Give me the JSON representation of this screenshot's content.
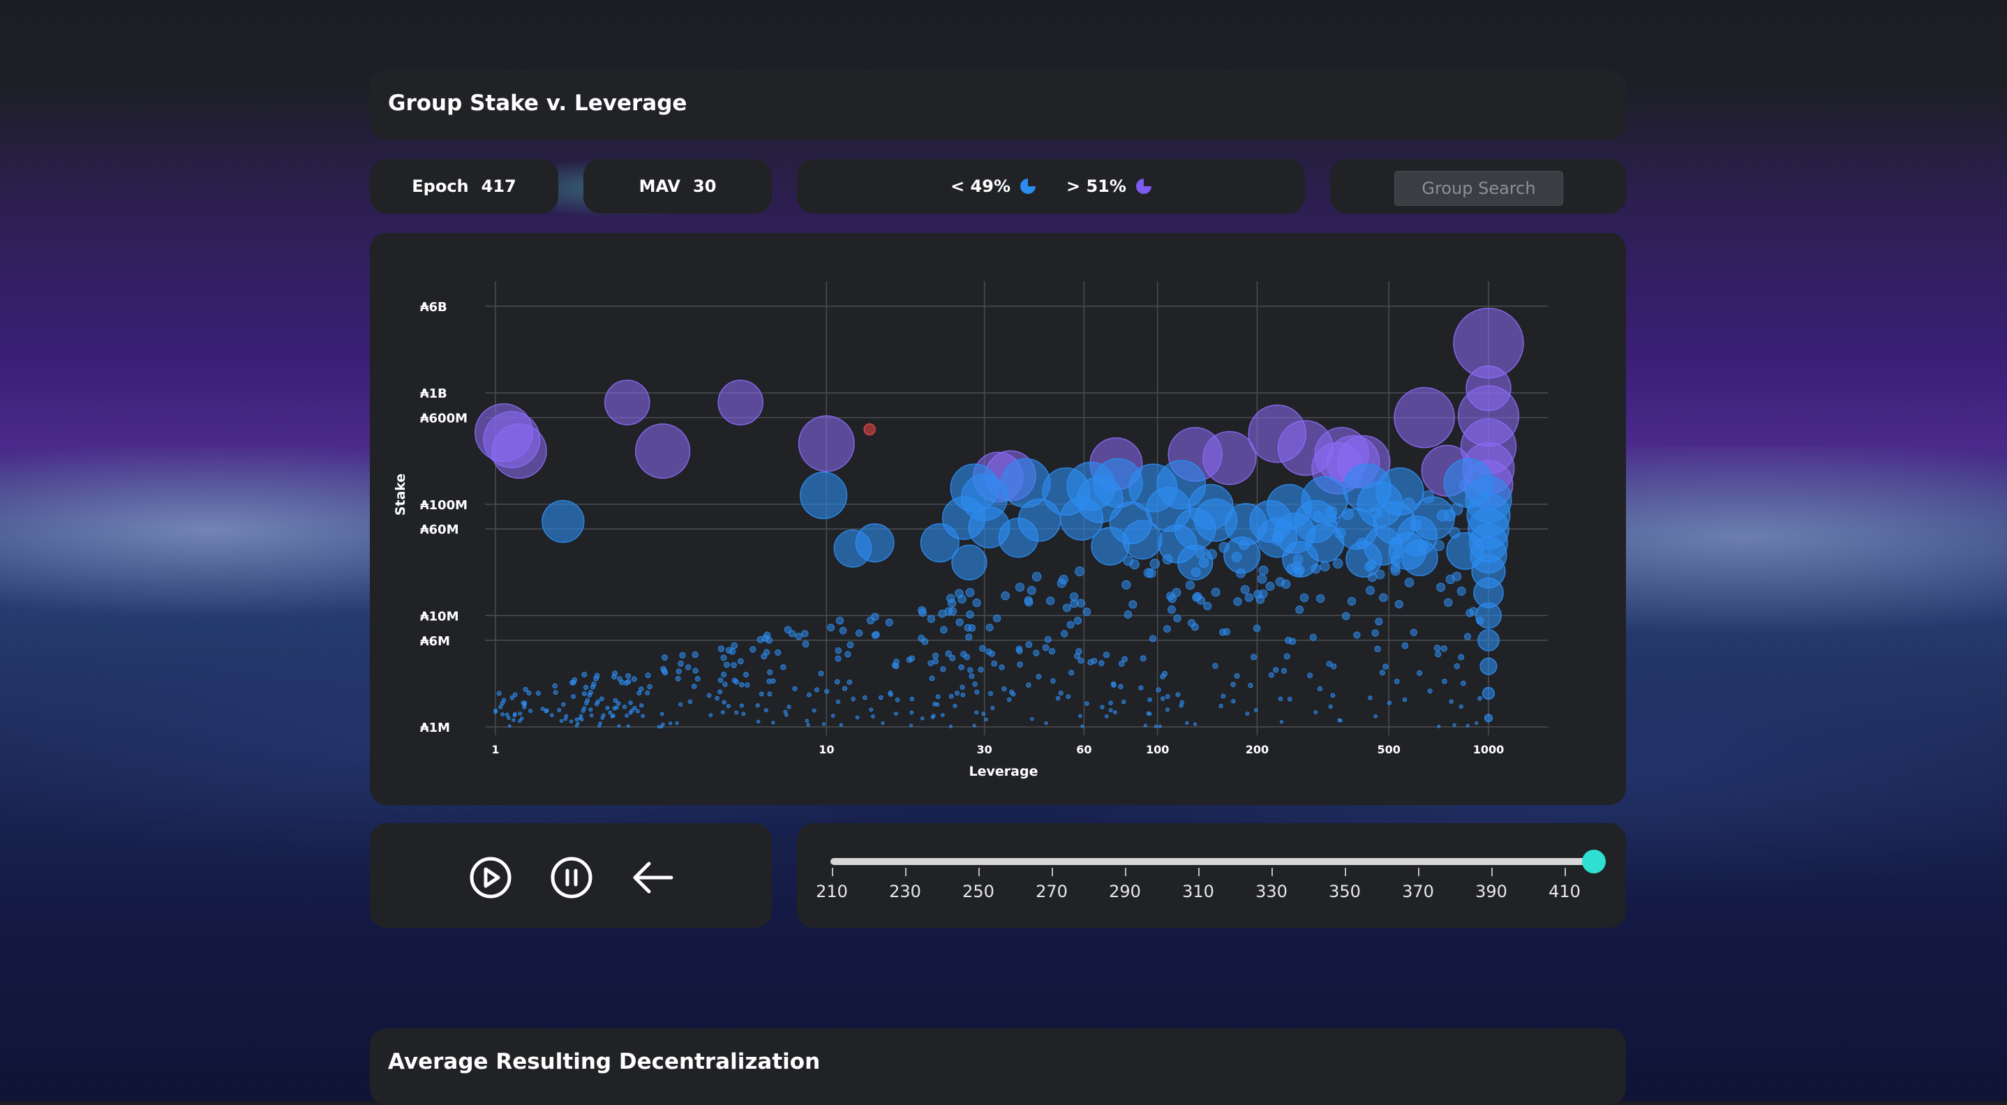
{
  "header": {
    "title": "Group Stake v. Leverage"
  },
  "stats": {
    "epoch_label": "Epoch",
    "epoch_value": "417",
    "mav_label": "MAV",
    "mav_value": "30",
    "below_label": "< 49%",
    "above_label": "> 51%",
    "below_color": "#2d8cf0",
    "above_color": "#7c5cf0"
  },
  "search": {
    "placeholder": "Group Search"
  },
  "controls": {
    "play_icon": "play-icon",
    "pause_icon": "pause-icon",
    "back_icon": "arrow-left-icon"
  },
  "slider": {
    "ticks": [
      "210",
      "230",
      "250",
      "270",
      "290",
      "310",
      "330",
      "350",
      "370",
      "390",
      "410"
    ],
    "min": 210,
    "max": 417,
    "value": 417,
    "thumb_color": "#2ee0d2"
  },
  "footer": {
    "title": "Average Resulting Decentralization"
  },
  "chart_data": {
    "type": "scatter",
    "xlabel": "Leverage",
    "ylabel": "Stake",
    "x_scale": "log",
    "y_scale": "log",
    "xlim": [
      1,
      2000
    ],
    "ylim": [
      1000000,
      9000000000
    ],
    "x_ticks": [
      {
        "v": 1,
        "label": "1"
      },
      {
        "v": 10,
        "label": "10"
      },
      {
        "v": 30,
        "label": "30"
      },
      {
        "v": 60,
        "label": "60"
      },
      {
        "v": 100,
        "label": "100"
      },
      {
        "v": 200,
        "label": "200"
      },
      {
        "v": 500,
        "label": "500"
      },
      {
        "v": 1000,
        "label": "1000"
      }
    ],
    "y_ticks": [
      {
        "v": 1000000,
        "label": "₳1M"
      },
      {
        "v": 6000000,
        "label": "₳6M"
      },
      {
        "v": 10000000,
        "label": "₳10M"
      },
      {
        "v": 60000000,
        "label": "₳60M"
      },
      {
        "v": 100000000,
        "label": "₳100M"
      },
      {
        "v": 600000000,
        "label": "₳600M"
      },
      {
        "v": 1000000000,
        "label": "₳1B"
      },
      {
        "v": 6000000000,
        "label": "₳6B"
      }
    ],
    "grid": true,
    "colors": {
      "below": "#2d8cf0",
      "above": "#8a6cf5",
      "highlight": "#e04646"
    },
    "points": [
      {
        "x": 1.06,
        "y": 440000000,
        "c": "above"
      },
      {
        "x": 1.12,
        "y": 380000000,
        "c": "above"
      },
      {
        "x": 1.18,
        "y": 300000000,
        "c": "above"
      },
      {
        "x": 2.5,
        "y": 820000000,
        "c": "above"
      },
      {
        "x": 5.5,
        "y": 820000000,
        "c": "above"
      },
      {
        "x": 3.2,
        "y": 300000000,
        "c": "above"
      },
      {
        "x": 10,
        "y": 350000000,
        "c": "above"
      },
      {
        "x": 1.6,
        "y": 70000000,
        "c": "below"
      },
      {
        "x": 9.8,
        "y": 120000000,
        "c": "below"
      },
      {
        "x": 13.5,
        "y": 470000000,
        "c": "highlight"
      },
      {
        "x": 1000,
        "y": 2800000000,
        "c": "above"
      },
      {
        "x": 1000,
        "y": 1100000000,
        "c": "above"
      },
      {
        "x": 1000,
        "y": 620000000,
        "c": "above"
      },
      {
        "x": 1000,
        "y": 330000000,
        "c": "above"
      },
      {
        "x": 1000,
        "y": 210000000,
        "c": "above"
      },
      {
        "x": 1000,
        "y": 150000000,
        "c": "above"
      },
      {
        "x": 1000,
        "y": 110000000,
        "c": "below"
      },
      {
        "x": 1000,
        "y": 80000000,
        "c": "below"
      },
      {
        "x": 1000,
        "y": 60000000,
        "c": "below"
      },
      {
        "x": 1000,
        "y": 45000000,
        "c": "below"
      },
      {
        "x": 1000,
        "y": 35000000,
        "c": "below"
      },
      {
        "x": 1000,
        "y": 25000000,
        "c": "below"
      },
      {
        "x": 1000,
        "y": 16000000,
        "c": "below"
      },
      {
        "x": 1000,
        "y": 10000000,
        "c": "below"
      },
      {
        "x": 1000,
        "y": 6000000,
        "c": "below"
      },
      {
        "x": 1000,
        "y": 3500000,
        "c": "below"
      },
      {
        "x": 1000,
        "y": 2000000,
        "c": "below"
      },
      {
        "x": 1000,
        "y": 1200000,
        "c": "below"
      },
      {
        "x": 640,
        "y": 600000000,
        "c": "above"
      },
      {
        "x": 230,
        "y": 430000000,
        "c": "above"
      },
      {
        "x": 280,
        "y": 320000000,
        "c": "above"
      },
      {
        "x": 130,
        "y": 280000000,
        "c": "above"
      },
      {
        "x": 165,
        "y": 260000000,
        "c": "above"
      },
      {
        "x": 75,
        "y": 230000000,
        "c": "above"
      },
      {
        "x": 360,
        "y": 280000000,
        "c": "above"
      },
      {
        "x": 390,
        "y": 240000000,
        "c": "above"
      },
      {
        "x": 420,
        "y": 240000000,
        "c": "above"
      },
      {
        "x": 350,
        "y": 210000000,
        "c": "above"
      },
      {
        "x": 36,
        "y": 180000000,
        "c": "above"
      },
      {
        "x": 33,
        "y": 175000000,
        "c": "above"
      },
      {
        "x": 750,
        "y": 200000000,
        "c": "above"
      },
      {
        "x": 28,
        "y": 140000000,
        "c": "below"
      },
      {
        "x": 40,
        "y": 155000000,
        "c": "below"
      },
      {
        "x": 53,
        "y": 130000000,
        "c": "below"
      },
      {
        "x": 63,
        "y": 145000000,
        "c": "below"
      },
      {
        "x": 76,
        "y": 155000000,
        "c": "below"
      },
      {
        "x": 97,
        "y": 140000000,
        "c": "below"
      },
      {
        "x": 118,
        "y": 150000000,
        "c": "below"
      },
      {
        "x": 430,
        "y": 140000000,
        "c": "below"
      },
      {
        "x": 540,
        "y": 130000000,
        "c": "below"
      },
      {
        "x": 870,
        "y": 155000000,
        "c": "below"
      },
      {
        "x": 30,
        "y": 115000000,
        "c": "below"
      },
      {
        "x": 67,
        "y": 110000000,
        "c": "below"
      },
      {
        "x": 108,
        "y": 90000000,
        "c": "below"
      },
      {
        "x": 145,
        "y": 95000000,
        "c": "below"
      },
      {
        "x": 250,
        "y": 95000000,
        "c": "below"
      },
      {
        "x": 320,
        "y": 110000000,
        "c": "below"
      },
      {
        "x": 470,
        "y": 100000000,
        "c": "below"
      },
      {
        "x": 26,
        "y": 75000000,
        "c": "below"
      },
      {
        "x": 44,
        "y": 72000000,
        "c": "below"
      },
      {
        "x": 59,
        "y": 74000000,
        "c": "below"
      },
      {
        "x": 83,
        "y": 68000000,
        "c": "below"
      },
      {
        "x": 150,
        "y": 72000000,
        "c": "below"
      },
      {
        "x": 185,
        "y": 66000000,
        "c": "below"
      },
      {
        "x": 220,
        "y": 70000000,
        "c": "below"
      },
      {
        "x": 300,
        "y": 70000000,
        "c": "below"
      },
      {
        "x": 520,
        "y": 68000000,
        "c": "below"
      },
      {
        "x": 680,
        "y": 75000000,
        "c": "below"
      },
      {
        "x": 31,
        "y": 62000000,
        "c": "below"
      },
      {
        "x": 130,
        "y": 60000000,
        "c": "below"
      },
      {
        "x": 260,
        "y": 55000000,
        "c": "below"
      },
      {
        "x": 400,
        "y": 60000000,
        "c": "below"
      },
      {
        "x": 610,
        "y": 52000000,
        "c": "below"
      },
      {
        "x": 38,
        "y": 50000000,
        "c": "below"
      },
      {
        "x": 90,
        "y": 48000000,
        "c": "below"
      },
      {
        "x": 230,
        "y": 50000000,
        "c": "below"
      },
      {
        "x": 12,
        "y": 40000000,
        "c": "below"
      },
      {
        "x": 14,
        "y": 45000000,
        "c": "below"
      },
      {
        "x": 22,
        "y": 45000000,
        "c": "below"
      },
      {
        "x": 72,
        "y": 42000000,
        "c": "below"
      },
      {
        "x": 115,
        "y": 44000000,
        "c": "below"
      },
      {
        "x": 320,
        "y": 45000000,
        "c": "below"
      },
      {
        "x": 480,
        "y": 42000000,
        "c": "below"
      },
      {
        "x": 570,
        "y": 38000000,
        "c": "below"
      },
      {
        "x": 130,
        "y": 30000000,
        "c": "below"
      },
      {
        "x": 27,
        "y": 30000000,
        "c": "below"
      },
      {
        "x": 180,
        "y": 35000000,
        "c": "below"
      },
      {
        "x": 270,
        "y": 32000000,
        "c": "below"
      },
      {
        "x": 420,
        "y": 32000000,
        "c": "below"
      },
      {
        "x": 620,
        "y": 33000000,
        "c": "below"
      },
      {
        "x": 850,
        "y": 38000000,
        "c": "below"
      }
    ],
    "cloud_seed": 7
  }
}
